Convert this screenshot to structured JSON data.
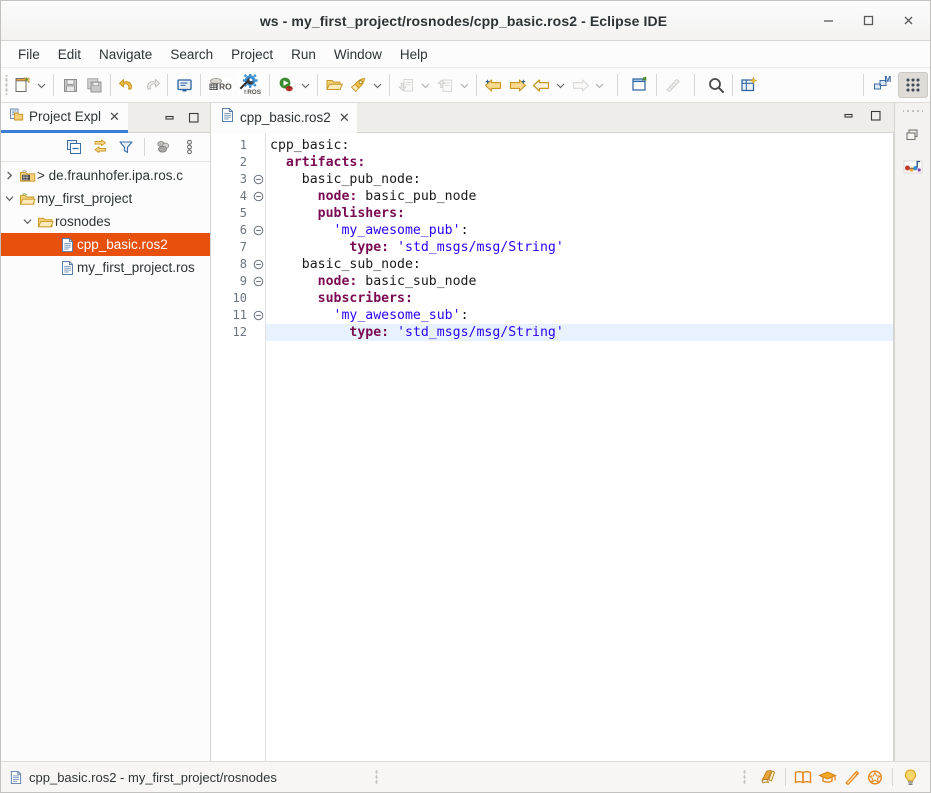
{
  "window": {
    "title": "ws - my_first_project/rosnodes/cpp_basic.ros2 - Eclipse IDE",
    "minimize_label": "–",
    "maximize_label": "□",
    "close_label": "✕"
  },
  "menubar": {
    "items": [
      {
        "label": "File"
      },
      {
        "label": "Edit"
      },
      {
        "label": "Navigate"
      },
      {
        "label": "Search"
      },
      {
        "label": "Project"
      },
      {
        "label": "Run"
      },
      {
        "label": "Window"
      },
      {
        "label": "Help"
      }
    ]
  },
  "toolbar": {
    "items": [
      {
        "name": "new-wizard-button",
        "icon": "new-file-icon"
      },
      {
        "name": "new-wizard-dropdown",
        "icon": "chevron-down-icon"
      },
      {
        "name": "save-button",
        "icon": "save-icon"
      },
      {
        "name": "save-all-button",
        "icon": "save-all-icon"
      },
      {
        "name": "undo-button",
        "icon": "undo-arrow-icon"
      },
      {
        "name": "redo-button",
        "icon": "redo-arrow-icon"
      },
      {
        "name": "console-button",
        "icon": "console-icon"
      },
      {
        "name": "ros-package-button",
        "icon": "ros-package-icon"
      },
      {
        "name": "ros-build-button",
        "icon": "ros-wrench-icon"
      },
      {
        "name": "debug-button",
        "icon": "debug-bug-icon"
      },
      {
        "name": "debug-dropdown",
        "icon": "chevron-down-icon"
      },
      {
        "name": "run-external-tools-button",
        "icon": "open-folder-icon"
      },
      {
        "name": "run-button",
        "icon": "run-rocket-icon"
      },
      {
        "name": "run-dropdown",
        "icon": "chevron-down-icon"
      },
      {
        "name": "next-annotation-button",
        "icon": "next-annotation-icon"
      },
      {
        "name": "next-annotation-dropdown",
        "icon": "chevron-down-icon"
      },
      {
        "name": "previous-annotation-button",
        "icon": "previous-annotation-icon"
      },
      {
        "name": "previous-annotation-dropdown",
        "icon": "chevron-down-icon"
      },
      {
        "name": "back-to-history-button",
        "icon": "back-star-arrow-icon"
      },
      {
        "name": "forward-history-button",
        "icon": "forward-star-arrow-icon"
      },
      {
        "name": "back-button",
        "icon": "back-arrow-icon"
      },
      {
        "name": "back-dropdown",
        "icon": "chevron-down-icon"
      },
      {
        "name": "forward-button",
        "icon": "forward-arrow-icon"
      },
      {
        "name": "forward-dropdown",
        "icon": "chevron-down-icon"
      },
      {
        "name": "new-java-project-button",
        "icon": "new-window-icon"
      },
      {
        "name": "ruler-button",
        "icon": "ruler-icon"
      },
      {
        "name": "search-button",
        "icon": "search-icon"
      },
      {
        "name": "open-perspective-button",
        "icon": "open-perspective-icon"
      },
      {
        "name": "modeling-perspective-button",
        "icon": "modeling-m-icon"
      },
      {
        "name": "quick-access-button",
        "icon": "grid-dots-icon"
      }
    ]
  },
  "project_explorer": {
    "tab_label": "Project Expl",
    "tab_close": "✕",
    "tab_icon": "project-explorer-icon",
    "view_minimize": "minimize-icon",
    "view_maximize": "maximize-icon",
    "toolbar_items": [
      {
        "name": "collapse-all-button",
        "icon": "collapse-all-icon"
      },
      {
        "name": "link-with-editor-button",
        "icon": "link-editor-icon"
      },
      {
        "name": "filters-button",
        "icon": "filter-funnel-icon"
      },
      {
        "name": "working-sets-button",
        "icon": "working-sets-icon"
      },
      {
        "name": "view-menu-button",
        "icon": "view-menu-icon"
      }
    ],
    "tree": [
      {
        "label": "> de.fraunhofer.ipa.ros.c",
        "indent": 0,
        "twisty": "collapsed",
        "icon": "java-project-icon",
        "selected": false
      },
      {
        "label": "my_first_project",
        "indent": 0,
        "twisty": "expanded",
        "icon": "open-project-icon",
        "selected": false
      },
      {
        "label": "rosnodes",
        "indent": 1,
        "twisty": "expanded",
        "icon": "folder-icon",
        "selected": false
      },
      {
        "label": "cpp_basic.ros2",
        "indent": 2,
        "twisty": "none",
        "icon": "file-icon",
        "selected": true
      },
      {
        "label": "my_first_project.ros",
        "indent": 2,
        "twisty": "none",
        "icon": "file-icon",
        "selected": false
      }
    ]
  },
  "editor": {
    "tab_label": "cpp_basic.ros2",
    "tab_close": "✕",
    "tab_icon": "file-icon",
    "minimize": "minimize-icon",
    "maximize": "maximize-icon",
    "highlighted_line": 12,
    "fold_lines": [
      3,
      4,
      6,
      8,
      9,
      11
    ],
    "lines": [
      {
        "n": 1,
        "indent": 0,
        "tokens": [
          {
            "t": "cpp_basic:",
            "c": "p"
          }
        ]
      },
      {
        "n": 2,
        "indent": 1,
        "tokens": [
          {
            "t": "artifacts:",
            "c": "k"
          }
        ]
      },
      {
        "n": 3,
        "indent": 2,
        "tokens": [
          {
            "t": "basic_pub_node:",
            "c": "p"
          }
        ]
      },
      {
        "n": 4,
        "indent": 3,
        "tokens": [
          {
            "t": "node:",
            "c": "k"
          },
          {
            "t": " basic_pub_node",
            "c": "p"
          }
        ]
      },
      {
        "n": 5,
        "indent": 3,
        "tokens": [
          {
            "t": "publishers:",
            "c": "k"
          }
        ]
      },
      {
        "n": 6,
        "indent": 4,
        "tokens": [
          {
            "t": "'my_awesome_pub'",
            "c": "s"
          },
          {
            "t": ":",
            "c": "p"
          }
        ]
      },
      {
        "n": 7,
        "indent": 5,
        "tokens": [
          {
            "t": "type:",
            "c": "k"
          },
          {
            "t": " ",
            "c": "p"
          },
          {
            "t": "'std_msgs/msg/String'",
            "c": "s"
          }
        ]
      },
      {
        "n": 8,
        "indent": 2,
        "tokens": [
          {
            "t": "basic_sub_node:",
            "c": "p"
          }
        ]
      },
      {
        "n": 9,
        "indent": 3,
        "tokens": [
          {
            "t": "node:",
            "c": "k"
          },
          {
            "t": " basic_sub_node",
            "c": "p"
          }
        ]
      },
      {
        "n": 10,
        "indent": 3,
        "tokens": [
          {
            "t": "subscribers:",
            "c": "k"
          }
        ]
      },
      {
        "n": 11,
        "indent": 4,
        "tokens": [
          {
            "t": "'my_awesome_sub'",
            "c": "s"
          },
          {
            "t": ":",
            "c": "p"
          }
        ]
      },
      {
        "n": 12,
        "indent": 5,
        "tokens": [
          {
            "t": "type:",
            "c": "k"
          },
          {
            "t": " ",
            "c": "p"
          },
          {
            "t": "'std_msgs/msg/String'",
            "c": "s"
          }
        ]
      }
    ]
  },
  "right_bar": {
    "items": [
      {
        "name": "restore-view-button",
        "icon": "restore-view-icon"
      },
      {
        "name": "ros-perspective-button",
        "icon": "ros-nodes-icon"
      }
    ]
  },
  "statusbar": {
    "icon": "file-icon",
    "text": "cpp_basic.ros2 - my_first_project/rosnodes",
    "right_items": [
      {
        "name": "show-source-button",
        "icon": "source-page-icon"
      },
      {
        "name": "cheatsheets-button",
        "icon": "book-icon"
      },
      {
        "name": "tutorial-button",
        "icon": "graduation-cap-icon"
      },
      {
        "name": "quick-fix-button",
        "icon": "magic-wand-icon"
      },
      {
        "name": "help-button",
        "icon": "help-circle-icon"
      },
      {
        "name": "tip-of-the-day-button",
        "icon": "lightbulb-icon"
      }
    ]
  },
  "colors": {
    "selection_orange": "#E8500E",
    "tab_underline_blue": "#3A7FD5",
    "key_maroon": "#7A0B52",
    "string_blue": "#2A00FF",
    "line_highlight": "#E8F2FE"
  }
}
